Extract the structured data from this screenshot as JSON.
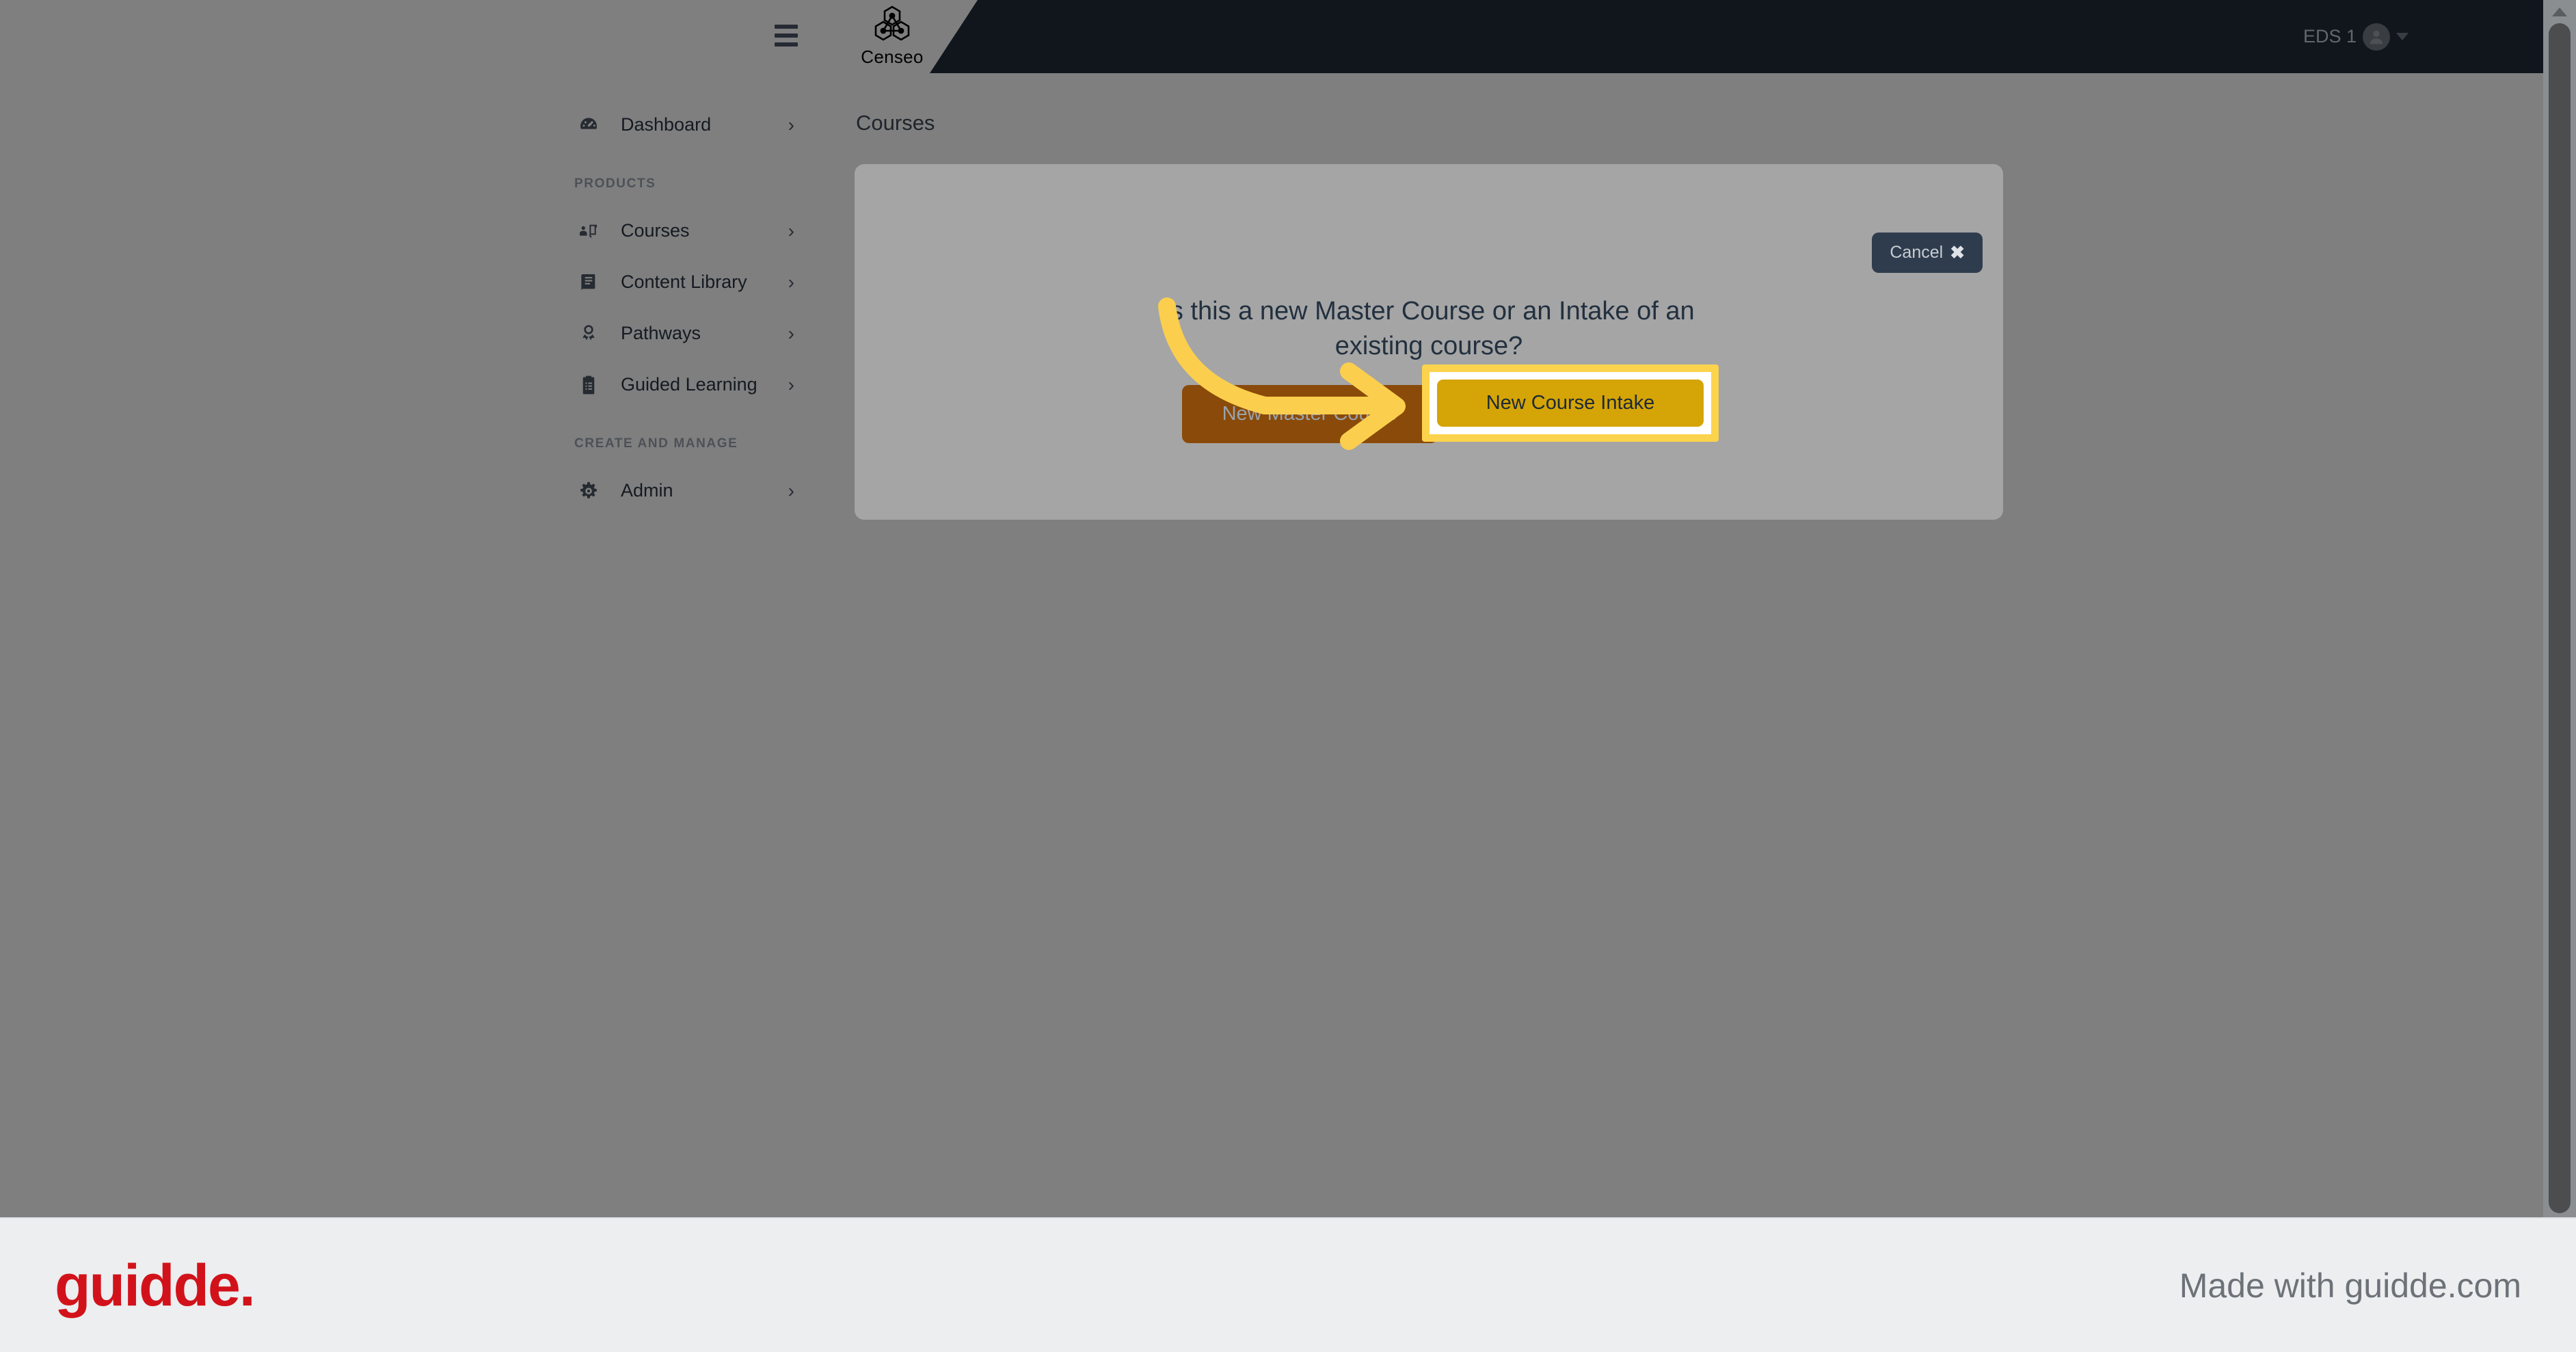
{
  "header": {
    "hamburger_icon": "hamburger-menu-icon",
    "logo_text": "Censeo",
    "logo_icon": "censeo-hexagon-nodes-logo",
    "user_name": "EDS 1",
    "avatar_icon": "user-avatar-icon",
    "caret_icon": "caret-down-icon"
  },
  "sidebar": {
    "items": [
      {
        "label": "Dashboard",
        "icon": "speedometer-icon",
        "chevron": "›"
      }
    ],
    "sections": [
      {
        "title": "PRODUCTS",
        "items": [
          {
            "label": "Courses",
            "icon": "presentation-person-icon",
            "chevron": "›"
          },
          {
            "label": "Content Library",
            "icon": "book-icon",
            "chevron": "›"
          },
          {
            "label": "Pathways",
            "icon": "award-ribbon-icon",
            "chevron": "›"
          },
          {
            "label": "Guided Learning",
            "icon": "clipboard-list-icon",
            "chevron": "›"
          }
        ]
      },
      {
        "title": "CREATE AND MANAGE",
        "items": [
          {
            "label": "Admin",
            "icon": "gear-icon",
            "chevron": "›"
          }
        ]
      }
    ]
  },
  "main": {
    "page_title": "Courses"
  },
  "modal": {
    "cancel_label": "Cancel",
    "cancel_icon": "✖",
    "question": "Is this a new Master Course or an Intake of an existing course?",
    "primary_button": "New Master Course",
    "secondary_button": "New Course Intake"
  },
  "annotation": {
    "arrow_icon": "curved-arrow-pointing-right",
    "arrow_color": "#fbcf4d",
    "highlight_border_color": "#fcd34d"
  },
  "scrollbar": {
    "up_arrow_icon": "scroll-up-arrow-icon",
    "thumb_name": "vertical-scroll-thumb"
  },
  "footer": {
    "logo_text": "guidde.",
    "made_with": "Made with guidde.com"
  },
  "colors": {
    "topbar_dark": "#222d3b",
    "accent_orange": "#8a4a09",
    "accent_yellow": "#d5a406",
    "highlight_yellow": "#fcd34d",
    "guidde_red": "#d2121a"
  }
}
